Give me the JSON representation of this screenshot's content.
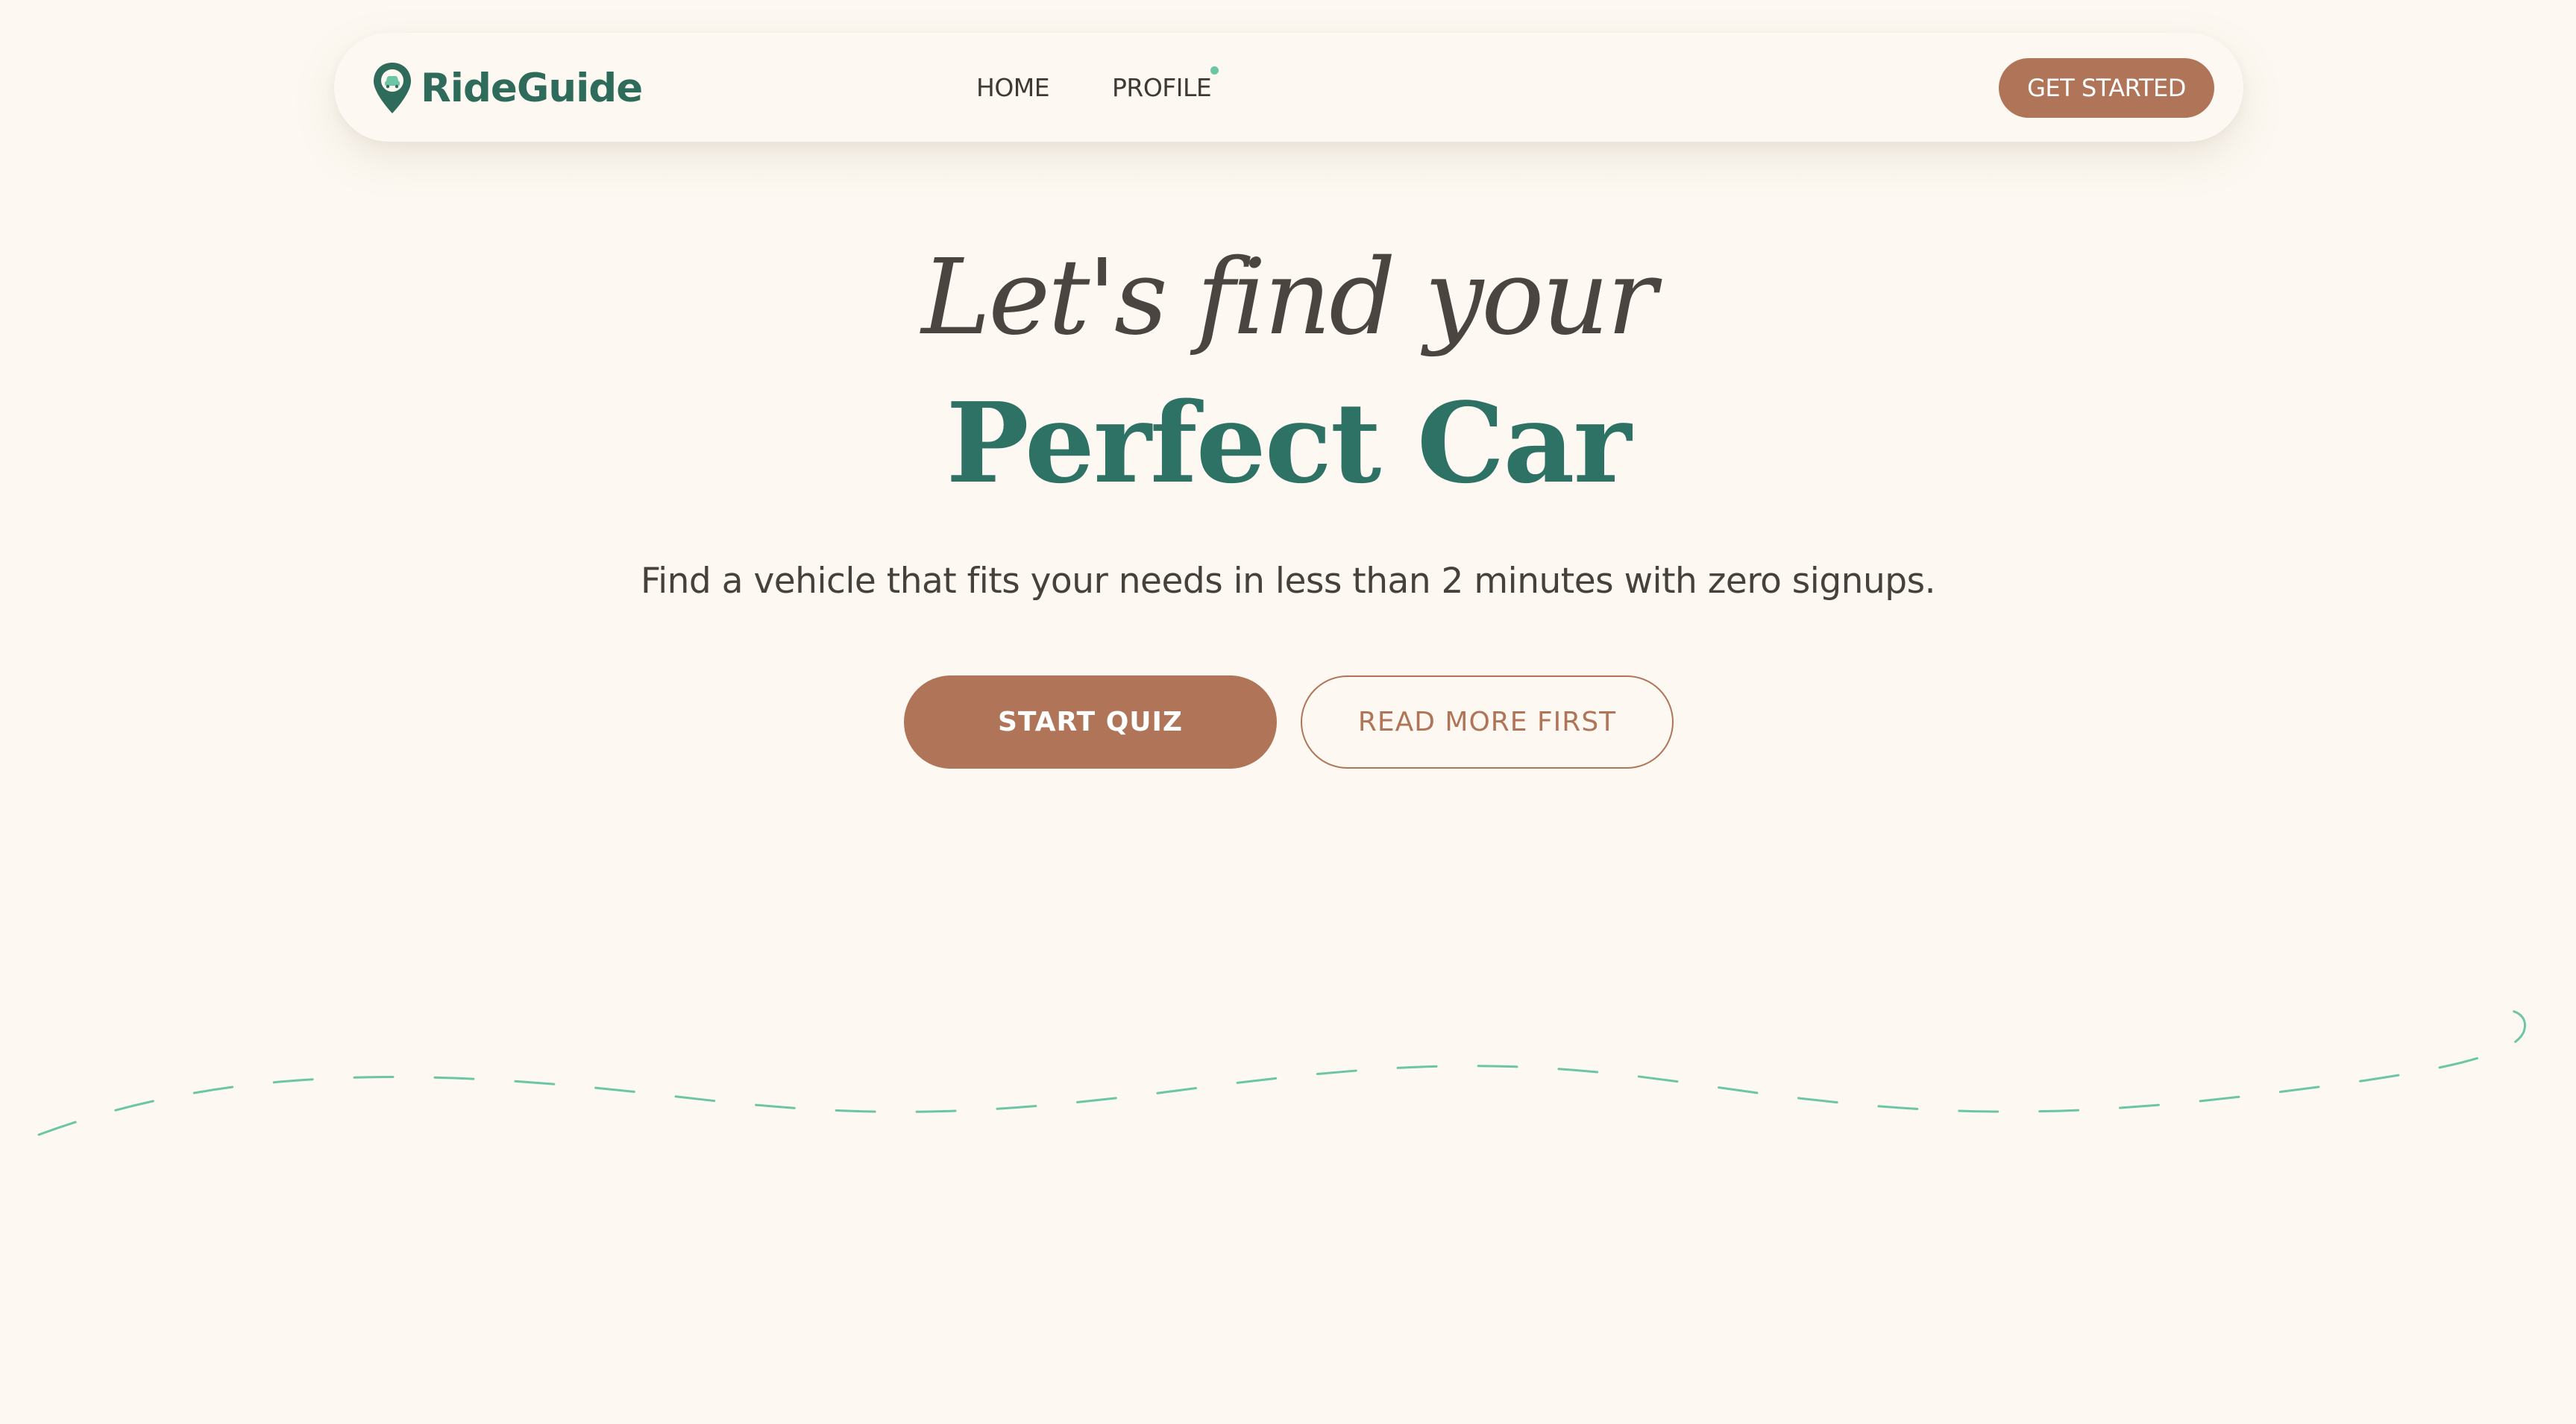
{
  "brand": {
    "name": "RideGuide",
    "icon": "map-pin-car-icon",
    "color": "#2f6b5a"
  },
  "nav": {
    "home_label": "HOME",
    "profile_label": "PROFILE",
    "get_started_label": "GET STARTED",
    "profile_notification_color": "#6cc6a6"
  },
  "hero": {
    "line1": "Let's find your",
    "line2": "Perfect Car",
    "subtitle": "Find a vehicle that fits your needs in less than 2 minutes with zero signups.",
    "primary_button_label": "START QUIZ",
    "secondary_button_label": "READ MORE FIRST"
  },
  "colors": {
    "background": "#fdf9f2",
    "accent": "#b07559",
    "heading_green": "#2e7266",
    "heading_dark": "#4a4540",
    "dashed_path": "#6cc6a6"
  }
}
